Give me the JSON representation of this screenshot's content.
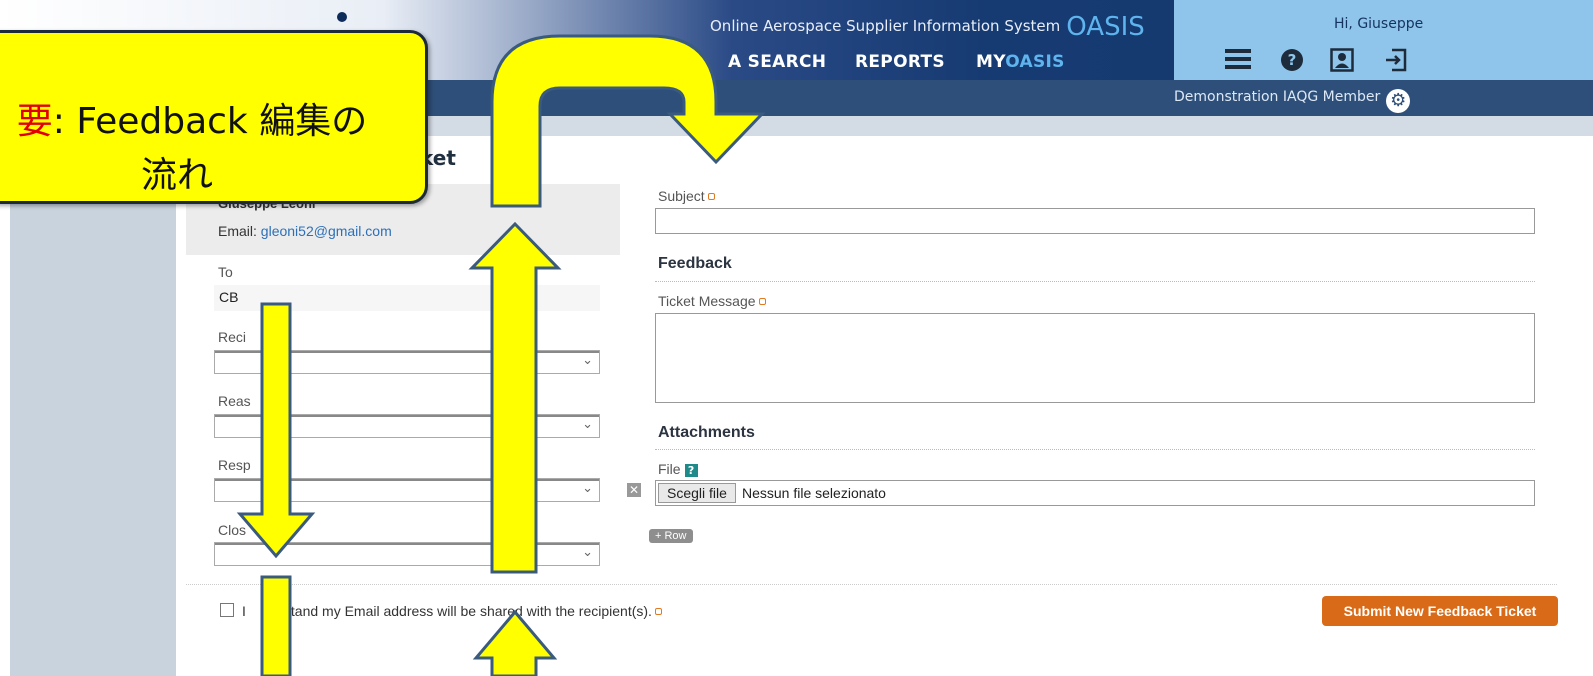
{
  "header": {
    "system_title": "Online Aerospace Supplier Information System",
    "system_acronym": "OASIS",
    "nav": {
      "data_search": "A SEARCH",
      "reports": "REPORTS",
      "my_prefix": "MY",
      "my_suffix": "OASIS"
    },
    "greeting": "Hi, Giuseppe",
    "member": "Demonstration IAQG Member",
    "icons": [
      "menu-icon",
      "help-icon",
      "profile-icon",
      "logout-icon",
      "gear-icon"
    ],
    "colors": {
      "header_dark": "#153a70",
      "accent_blue": "#5fb4ee",
      "user_panel": "#8fc5ea"
    }
  },
  "page": {
    "title_fragment": "ket"
  },
  "sender": {
    "name": "Giuseppe Leoni",
    "email_label": "Email:",
    "email": "gleoni52@gmail.com"
  },
  "left_form": {
    "to_label": "To",
    "to_value": "CB",
    "recipient_label": "Reci",
    "reason_label": "Reas",
    "response_label": "Resp",
    "close_label": "Clos",
    "consent_prefix": "I",
    "consent_text": "stand my Email address will be shared with the recipient(s)."
  },
  "right_form": {
    "subject_label": "Subject",
    "feedback_heading": "Feedback",
    "ticket_message_label": "Ticket Message",
    "attachments_heading": "Attachments",
    "file_label": "File",
    "choose_file": "Scegli file",
    "no_file": "Nessun file selezionato",
    "add_row": "+ Row",
    "submit": "Submit New Feedback Ticket"
  },
  "callout": {
    "highlight": "要",
    "line1_rest": ": Feedback 編集の",
    "line2": "流れ",
    "fill": "#ffff00"
  }
}
